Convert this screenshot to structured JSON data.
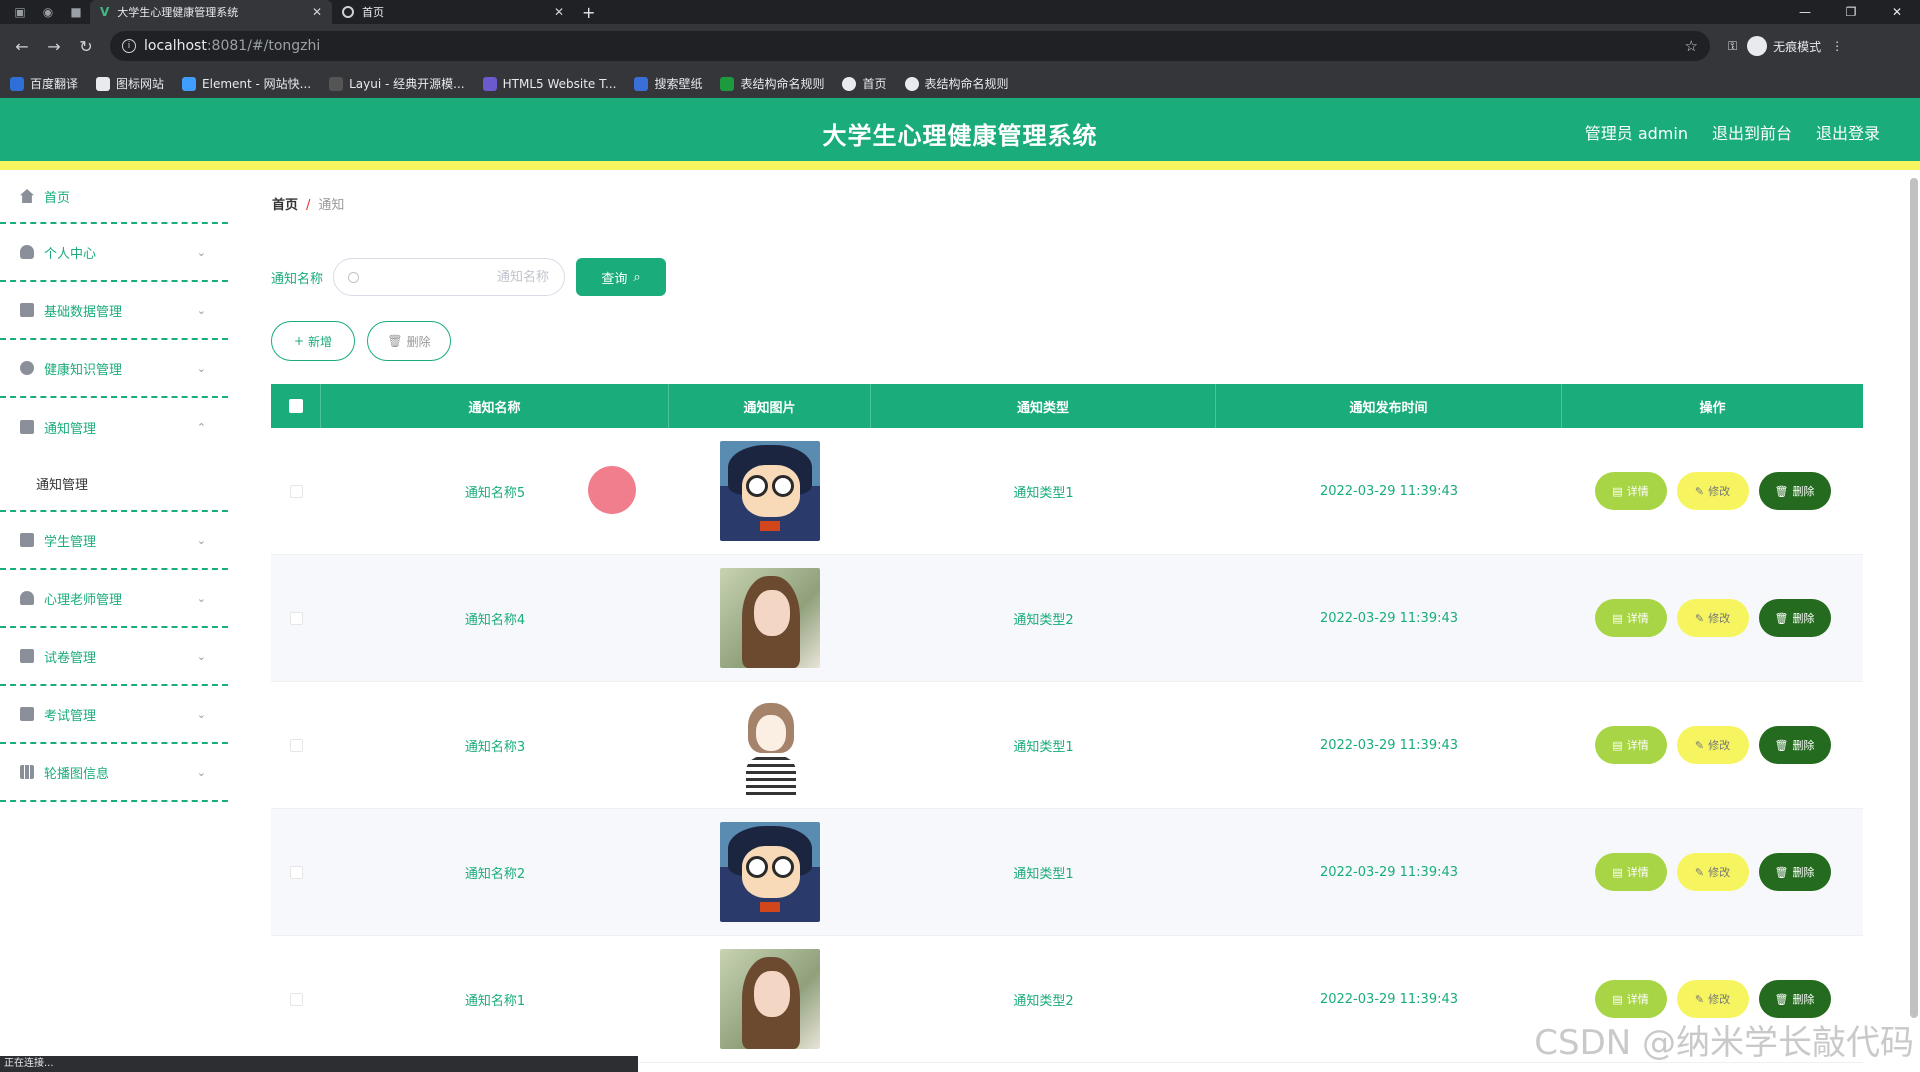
{
  "browser": {
    "tabs": [
      {
        "title": "大学生心理健康管理系统",
        "active": true
      },
      {
        "title": "首页",
        "active": false
      }
    ],
    "url_host": "localhost",
    "url_path": ":8081/#/tongzhi",
    "incognito_label": "无痕模式",
    "bookmarks": [
      "百度翻译",
      "图标网站",
      "Element - 网站快...",
      "Layui - 经典开源模...",
      "HTML5 Website T...",
      "搜索壁纸",
      "表结构命名规则",
      "首页",
      "表结构命名规则"
    ],
    "status_text": "正在连接..."
  },
  "header": {
    "title": "大学生心理健康管理系统",
    "admin_label": "管理员 admin",
    "back_front": "退出到前台",
    "logout": "退出登录"
  },
  "sidebar": {
    "items": [
      {
        "label": "首页",
        "icon": "home-icon"
      },
      {
        "label": "个人中心",
        "icon": "user-icon"
      },
      {
        "label": "基础数据管理",
        "icon": "chat-icon"
      },
      {
        "label": "健康知识管理",
        "icon": "clock-icon"
      },
      {
        "label": "通知管理",
        "icon": "briefcase-icon",
        "expanded": true
      },
      {
        "label": "学生管理",
        "icon": "message-icon"
      },
      {
        "label": "心理老师管理",
        "icon": "bell-off-icon"
      },
      {
        "label": "试卷管理",
        "icon": "clipboard-icon"
      },
      {
        "label": "考试管理",
        "icon": "monitor-icon"
      },
      {
        "label": "轮播图信息",
        "icon": "grid-icon"
      }
    ],
    "submenu_label": "通知管理"
  },
  "breadcrumb": {
    "home": "首页",
    "separator": "/",
    "current": "通知"
  },
  "search": {
    "label": "通知名称",
    "placeholder": "通知名称",
    "value": "",
    "button": "查询"
  },
  "actions": {
    "add": "新增",
    "delete": "删除"
  },
  "table": {
    "headers": [
      "通知名称",
      "通知图片",
      "通知类型",
      "通知发布时间",
      "操作"
    ],
    "rows": [
      {
        "name": "通知名称5",
        "image": "conan",
        "type": "通知类型1",
        "time": "2022-03-29 11:39:43"
      },
      {
        "name": "通知名称4",
        "image": "girl",
        "type": "通知类型2",
        "time": "2022-03-29 11:39:43"
      },
      {
        "name": "通知名称3",
        "image": "sketch",
        "type": "通知类型1",
        "time": "2022-03-29 11:39:43"
      },
      {
        "name": "通知名称2",
        "image": "conan",
        "type": "通知类型1",
        "time": "2022-03-29 11:39:43"
      },
      {
        "name": "通知名称1",
        "image": "girl",
        "type": "通知类型2",
        "time": "2022-03-29 11:39:43"
      }
    ],
    "ops": {
      "detail": "详情",
      "edit": "修改",
      "delete": "删除"
    }
  },
  "watermark": "CSDN @纳米学长敲代码",
  "colors": {
    "primary": "#1aac7a",
    "accent_yellow": "#f6f560",
    "detail": "#a8d545",
    "delete": "#246b1f"
  }
}
